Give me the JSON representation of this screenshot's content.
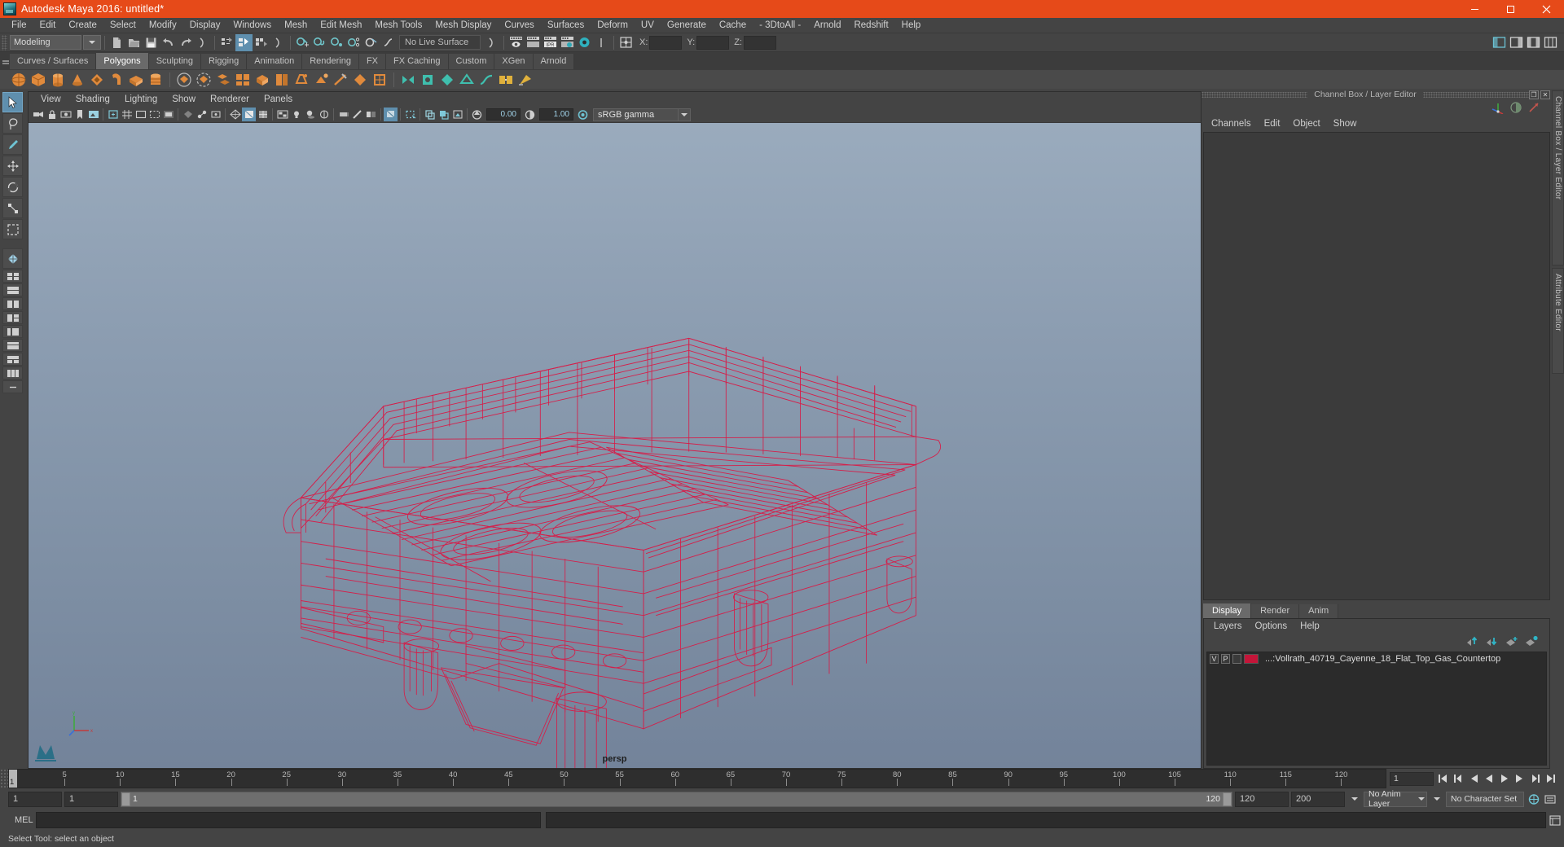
{
  "window": {
    "title": "Autodesk Maya 2016: untitled*",
    "icon": "maya-app-icon",
    "minimize": "–",
    "maximize": "❐",
    "close": "✕"
  },
  "menubar": {
    "items": [
      "File",
      "Edit",
      "Create",
      "Select",
      "Modify",
      "Display",
      "Windows",
      "Mesh",
      "Edit Mesh",
      "Mesh Tools",
      "Mesh Display",
      "Curves",
      "Surfaces",
      "Deform",
      "UV",
      "Generate",
      "Cache",
      "- 3DtoAll -",
      "Arnold",
      "Redshift",
      "Help"
    ]
  },
  "statusline": {
    "menuset": "Modeling",
    "live_surface": "No Live Surface",
    "coord_x_label": "X:",
    "coord_y_label": "Y:",
    "coord_z_label": "Z:",
    "coord_x_value": "",
    "coord_y_value": "",
    "coord_z_value": "",
    "icons": [
      "new-scene-icon",
      "open-scene-icon",
      "save-scene-icon",
      "undo-icon",
      "redo-icon",
      "select-by-hierarchy-icon",
      "select-by-object-icon",
      "select-by-component-icon",
      "snap-to-grid-icon",
      "snap-to-curve-icon",
      "snap-to-point-icon",
      "snap-to-projected-center-icon",
      "snap-to-view-plane-icon",
      "render-view-icon",
      "render-sequence-icon",
      "ipr-render-icon",
      "render-settings-icon",
      "hypershade-icon",
      "toggle-editor-icon"
    ]
  },
  "shelf": {
    "tabs": [
      "Curves / Surfaces",
      "Polygons",
      "Sculpting",
      "Rigging",
      "Animation",
      "Rendering",
      "FX",
      "FX Caching",
      "Custom",
      "XGen",
      "Arnold"
    ],
    "active_tab": "Polygons",
    "icons": [
      "poly-sphere-icon",
      "poly-cube-icon",
      "poly-cylinder-icon",
      "poly-cone-icon",
      "poly-torus-icon",
      "poly-plane-icon",
      "poly-disc-icon",
      "poly-platonic-icon",
      "poly-pyramid-icon",
      "poly-prism-icon",
      "poly-pipe-icon",
      "poly-helix-icon",
      "poly-gear-icon",
      "poly-soccer-ball-icon",
      "poly-super-ellipse-icon",
      "combine-icon",
      "separate-icon",
      "booleans-icon",
      "smooth-icon",
      "extrude-icon",
      "bevel-icon",
      "bridge-icon",
      "append-polygon-icon",
      "multi-cut-icon",
      "target-weld-icon",
      "quad-draw-icon",
      "sculpt-icon",
      "mirror-icon",
      "fill-hole-icon",
      "reduce-icon",
      "crease-icon",
      "soften-harden-edge-icon",
      "transfer-attributes-icon",
      "remesh-icon"
    ]
  },
  "toolbox": {
    "tools": [
      "select-tool",
      "lasso-select-tool",
      "paint-select-tool",
      "move-tool",
      "rotate-tool",
      "scale-tool",
      "last-tool-used",
      "show-manipulator-tool"
    ],
    "layouts": [
      "single-perspective-layout",
      "four-view-layout",
      "two-stacked-layout",
      "two-side-by-side-layout",
      "three-pane-layout",
      "outliner-persp-layout",
      "hypergraph-layout",
      "persp-graph-layout",
      "quad-extra-layout",
      "more-layouts"
    ]
  },
  "viewport": {
    "menus": [
      "View",
      "Shading",
      "Lighting",
      "Show",
      "Renderer",
      "Panels"
    ],
    "camera_label": "persp",
    "exposure_value": "0.00",
    "gamma_value": "1.00",
    "color_management": "sRGB gamma",
    "toolbar_icons": [
      "select-camera-icon",
      "lock-camera-icon",
      "camera-attributes-icon",
      "bookmark-icon",
      "image-plane-icon",
      "two-d-pan-zoom-icon",
      "grid-toggle-icon",
      "film-gate-icon",
      "resolution-gate-icon",
      "gate-mask-icon",
      "xray-toggle-icon",
      "xray-joints-icon",
      "xray-active-icon",
      "wireframe-icon",
      "smooth-shade-icon",
      "shaded-wireframe-icon",
      "textured-icon",
      "lights-icon",
      "shadows-icon",
      "screen-space-ao-icon",
      "motion-blur-icon",
      "multisample-icon",
      "depth-of-field-icon",
      "isolate-select-icon",
      "grid-icon",
      "exposure-icon",
      "gamma-icon",
      "color-management-icon"
    ],
    "model_color": "#d81b47",
    "bg_top": "#9aabbd",
    "bg_bottom": "#73839a"
  },
  "right_panel": {
    "title": "Channel Box / Layer Editor",
    "restore_glyph": "❐",
    "close_glyph": "✕",
    "channel_menus": [
      "Channels",
      "Edit",
      "Object",
      "Show"
    ],
    "tool_icons": [
      "transform-manip-icon",
      "shaded-sphere-icon",
      "input-connections-icon"
    ],
    "vertical_tabs": [
      "Channel Box / Layer Editor",
      "Attribute Editor"
    ],
    "layer_editor": {
      "tabs": [
        "Display",
        "Render",
        "Anim"
      ],
      "active_tab": "Display",
      "menus": [
        "Layers",
        "Options",
        "Help"
      ],
      "button_icons": [
        "move-layer-up-icon",
        "move-layer-down-icon",
        "new-layer-icon",
        "new-layer-from-selected-icon"
      ],
      "layers": [
        {
          "visibility": "V",
          "playback": "P",
          "type": "",
          "color": "#c41539",
          "name": "...:Vollrath_40719_Cayenne_18_Flat_Top_Gas_Countertop"
        }
      ]
    }
  },
  "timeline": {
    "ticks": [
      5,
      10,
      15,
      20,
      25,
      30,
      35,
      40,
      45,
      50,
      55,
      60,
      65,
      70,
      75,
      80,
      85,
      90,
      95,
      100,
      105,
      110,
      115,
      120
    ],
    "current_frame": "1",
    "current_frame_field": "1",
    "range_start": "1",
    "range_end": "1",
    "playback_start": "1",
    "playback_end": "120",
    "anim_start": "120",
    "anim_end": "200",
    "anim_layer": "No Anim Layer",
    "character_set": "No Character Set",
    "playback_icons": [
      "go-to-start-icon",
      "step-back-key-icon",
      "step-back-frame-icon",
      "play-backwards-icon",
      "play-forwards-icon",
      "step-forward-frame-icon",
      "step-forward-key-icon",
      "go-to-end-icon"
    ],
    "extra_icons": [
      "auto-key-icon",
      "anim-preferences-icon"
    ]
  },
  "command_line": {
    "language": "MEL",
    "input_value": "",
    "output_value": "",
    "script-editor-icon": "script-editor-icon"
  },
  "status_bar": {
    "help_text": "Select Tool: select an object"
  }
}
